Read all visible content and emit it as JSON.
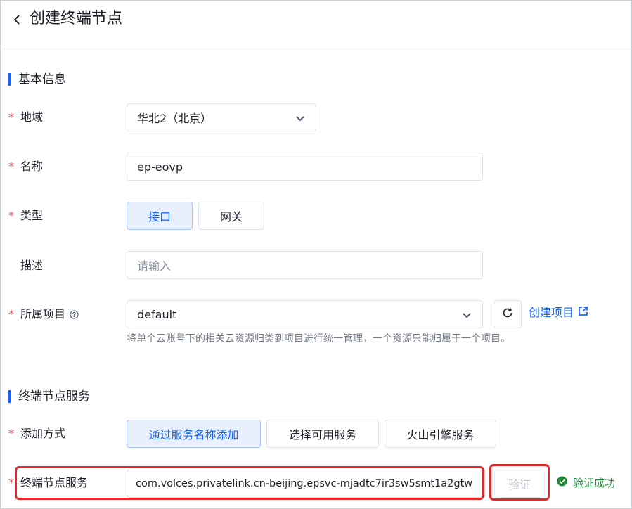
{
  "header": {
    "title": "创建终端节点"
  },
  "sections": {
    "basic": "基本信息",
    "service": "终端节点服务"
  },
  "form": {
    "region": {
      "label": "地域",
      "value": "华北2（北京）"
    },
    "name": {
      "label": "名称",
      "value": "ep-eovp"
    },
    "type": {
      "label": "类型",
      "options": [
        "接口",
        "网关"
      ],
      "selected": "接口"
    },
    "description": {
      "label": "描述",
      "placeholder": "请输入"
    },
    "project": {
      "label": "所属项目",
      "value": "default",
      "create_link": "创建项目",
      "hint": "将单个云账号下的相关云资源归类到项目进行统一管理，一个资源只能归属于一个项目。"
    },
    "add_method": {
      "label": "添加方式",
      "options": [
        "通过服务名称添加",
        "选择可用服务",
        "火山引擎服务"
      ],
      "selected": "通过服务名称添加"
    },
    "endpoint_service": {
      "label": "终端节点服务",
      "value": "com.volces.privatelink.cn-beijing.epsvc-mjadtc7ir3sw5smt1a2gtw",
      "verify_label": "验证",
      "status": "验证成功"
    }
  },
  "colors": {
    "accent": "#1664ff",
    "required": "#e34d59",
    "success": "#1f8a3a",
    "highlight": "#e02929"
  }
}
